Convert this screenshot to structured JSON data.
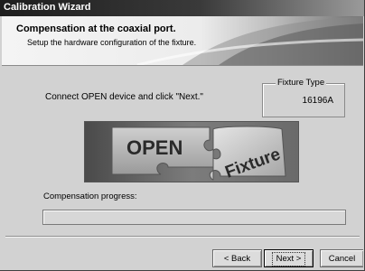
{
  "window": {
    "title": "Calibration Wizard"
  },
  "header": {
    "title": "Compensation at the coaxial port.",
    "subtitle": "Setup the hardware configuration of the fixture."
  },
  "main": {
    "instruction": "Connect OPEN device and click \"Next.\"",
    "fixture_type": {
      "label": "Fixture Type",
      "value": "16196A"
    },
    "banner": {
      "open_text": "OPEN",
      "fixture_text": "Fixture"
    },
    "progress": {
      "label": "Compensation progress:",
      "percent": 0
    }
  },
  "buttons": {
    "back": "< Back",
    "next": "Next >",
    "cancel": "Cancel"
  }
}
